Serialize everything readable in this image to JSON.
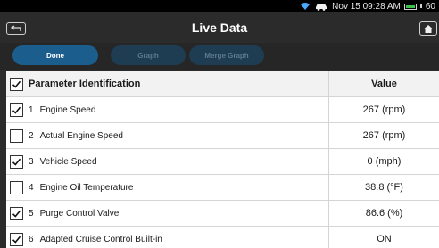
{
  "status": {
    "datetime": "Nov 15 09:28 AM",
    "battery_text": "60",
    "icons": [
      "wifi-icon",
      "car-icon",
      "battery-icon"
    ],
    "battery_color": "#3ac24a"
  },
  "header": {
    "title": "Live Data",
    "back_icon": "back-icon",
    "home_icon": "home-icon"
  },
  "tabs": {
    "done": "Done",
    "graph": "Graph",
    "merge_graph": "Merge Graph"
  },
  "table": {
    "header_param": "Parameter Identification",
    "header_value": "Value",
    "header_checked": true,
    "rows": [
      {
        "num": "1",
        "name": "Engine Speed",
        "value": "267 (rpm)",
        "checked": true
      },
      {
        "num": "2",
        "name": "Actual Engine Speed",
        "value": "267 (rpm)",
        "checked": false
      },
      {
        "num": "3",
        "name": "Vehicle Speed",
        "value": "0 (mph)",
        "checked": true
      },
      {
        "num": "4",
        "name": "Engine Oil Temperature",
        "value": "38.8 (°F)",
        "checked": false
      },
      {
        "num": "5",
        "name": "Purge Control Valve",
        "value": "86.6 (%)",
        "checked": true
      },
      {
        "num": "6",
        "name": "Adapted Cruise Control Built-in",
        "value": "ON",
        "checked": true
      }
    ]
  },
  "colors": {
    "accent": "#1b5d8c",
    "inactive_tab": "#1e3d52",
    "background": "#2b2b2b"
  }
}
